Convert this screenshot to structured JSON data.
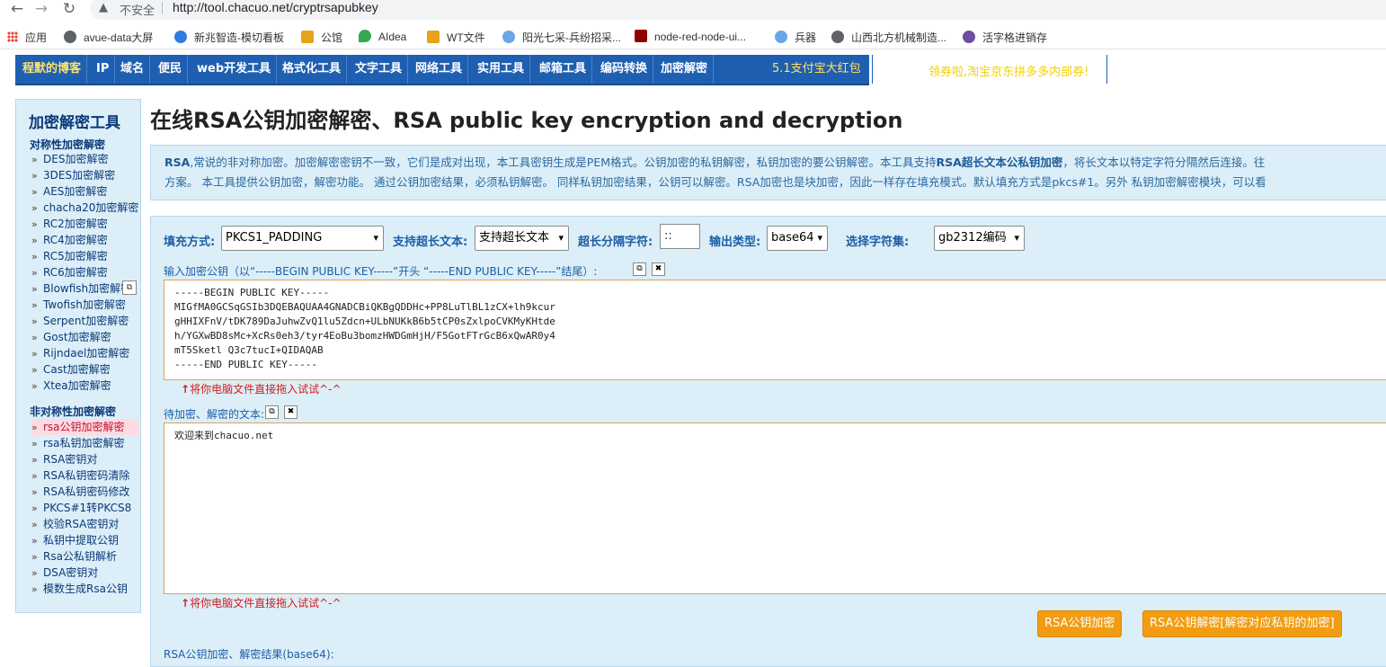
{
  "browser": {
    "insecure_label": "不安全",
    "url": "http://tool.chacuo.net/cryptrsapubkey",
    "bookmarks": [
      {
        "label": "应用",
        "icon": "apps-grid-icon"
      },
      {
        "label": "avue-data大屏",
        "icon": "globe-icon"
      },
      {
        "label": "新兆智造-模切看板",
        "icon": "swirl-icon"
      },
      {
        "label": "公馆",
        "icon": "cute-icon"
      },
      {
        "label": "AIdea",
        "icon": "map-pin-icon"
      },
      {
        "label": "WT文件",
        "icon": "cute-icon"
      },
      {
        "label": "阳光七采-兵纷招采...",
        "icon": "cloud-icon"
      },
      {
        "label": "node-red-node-ui...",
        "icon": "nodered-icon"
      },
      {
        "label": "兵器",
        "icon": "cloud-icon"
      },
      {
        "label": "山西北方机械制造...",
        "icon": "globe-icon"
      },
      {
        "label": "活字格进销存",
        "icon": "hzg-icon"
      }
    ]
  },
  "topnav": {
    "items": [
      "程默的博客",
      "IP",
      "域名",
      "便民",
      "web开发工具",
      "格式化工具",
      "文字工具",
      "网络工具",
      "实用工具",
      "邮箱工具",
      "编码转换",
      "加密解密"
    ],
    "promo": "5.1支付宝大红包",
    "banner_right": "领券啦,淘宝京东拼多多内部券!"
  },
  "sidebar": {
    "title": "加密解密工具",
    "sym_title": "对称性加密解密",
    "sym_items": [
      "DES加密解密",
      "3DES加密解密",
      "AES加密解密",
      "chacha20加密解密",
      "RC2加密解密",
      "RC4加密解密",
      "RC5加密解密",
      "RC6加密解密",
      "Blowfish加密解密",
      "Twofish加密解密",
      "Serpent加密解密",
      "Gost加密解密",
      "Rijndael加密解密",
      "Cast加密解密",
      "Xtea加密解密"
    ],
    "asym_title": "非对称性加密解密",
    "asym_items": [
      "rsa公钥加密解密",
      "rsa私钥加密解密",
      "RSA密钥对",
      "RSA私钥密码清除",
      "RSA私钥密码修改",
      "PKCS#1转PKCS8",
      "校验RSA密钥对",
      "私钥中提取公钥",
      "Rsa公私钥解析",
      "DSA密钥对",
      "模数生成Rsa公钥"
    ],
    "active": "rsa公钥加密解密"
  },
  "main": {
    "title": "在线RSA公钥加密解密、RSA public key encryption and decryption",
    "intro_line1_bold": "RSA",
    "intro_line1_a": ",常说的非对称加密。加密解密密钥不一致，它们是成对出现，本工具密钥生成是PEM格式。公钥加密的私钥解密，私钥加密的要公钥解密。本工具支持",
    "intro_line1_bold2": "RSA超长文本公私钥加密",
    "intro_line1_b": "，将长文本以特定字符分隔然后连接。往",
    "intro_line2": "方案。 本工具提供公钥加密，解密功能。 通过公钥加密结果，必须私钥解密。 同样私钥加密结果，公钥可以解密。RSA加密也是块加密，因此一样存在填充模式。默认填充方式是pkcs#1。另外 私钥加密解密模块，可以看",
    "options": {
      "padding_label": "填充方式:",
      "padding_value": "PKCS1_PADDING",
      "longtext_label": "支持超长文本:",
      "longtext_value": "支持超长文本",
      "sep_label": "超长分隔字符:",
      "sep_value": "::",
      "output_label": "输出类型:",
      "output_value": "base64",
      "charset_label": "选择字符集:",
      "charset_value": "gb2312编码"
    },
    "pubkey_label": "输入加密公钥（以“-----BEGIN PUBLIC KEY-----”开头 “-----END PUBLIC KEY-----”结尾）:",
    "pubkey_lines": [
      "-----BEGIN PUBLIC KEY-----",
      "MIGfMA0GCSqGSIb3DQEBAQUAA4GNADCBiQKBgQDDHc+PP8LuTlBL1zCX+lh9kcur",
      "gHHIXFnV/tDK789DaJuhwZvQ1lu5Zdcn+ULbNUKkB6b5tCP0sZxlpoCVKMyKHtde",
      "h/YGXwBD8sMc+XcRs0eh3/tyr4EoBu3bomzHWDGmHjH/F5GotFTrGcB6xQwAR0y4",
      "mT5Sketl Q3c7tucI+QIDAQAB",
      "-----END PUBLIC KEY-----"
    ],
    "drop_hint_arrow": "↑",
    "drop_hint": "将你电脑文件直接拖入试试^-^",
    "text_label": "待加密、解密的文本:",
    "text_value": "欢迎来到chacuo.net",
    "btn_encrypt": "RSA公钥加密",
    "btn_decrypt": "RSA公钥解密[解密对应私钥的加密]",
    "bottom_label": "RSA公钥加密、解密结果(base64):"
  }
}
